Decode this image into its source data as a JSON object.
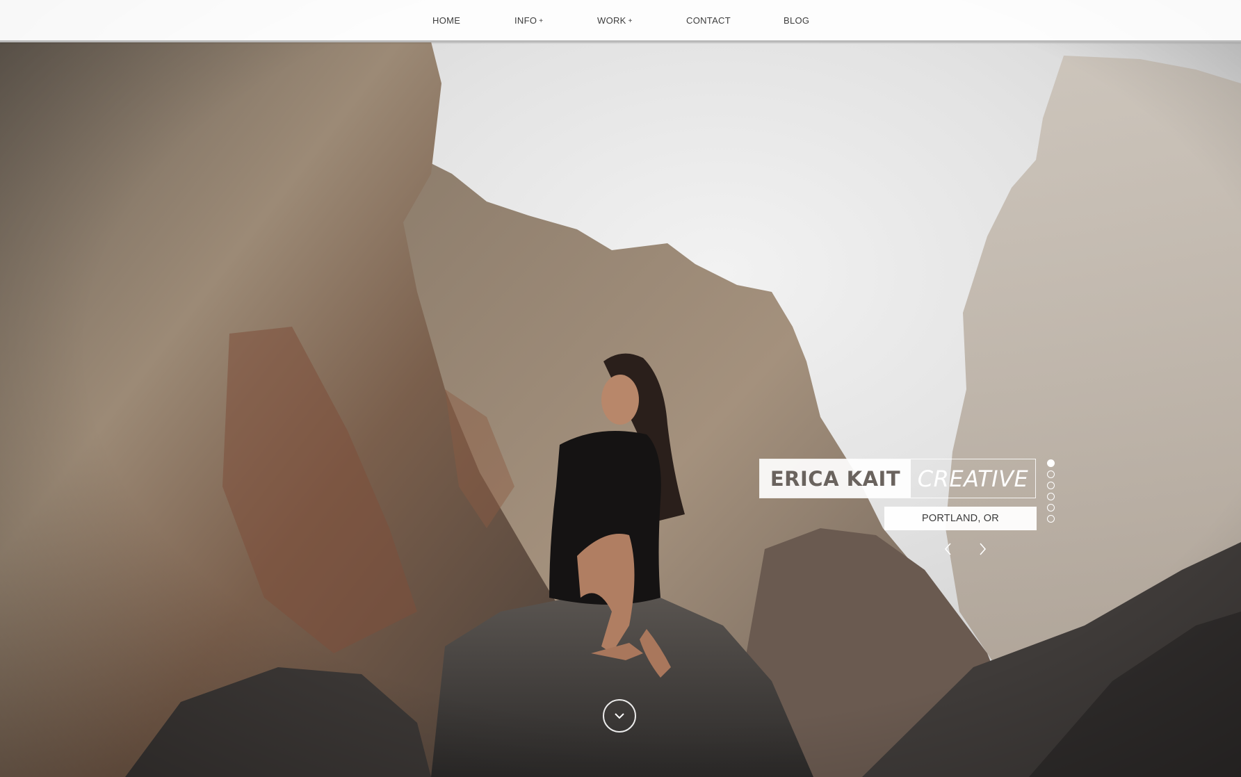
{
  "nav": {
    "items": [
      {
        "label": "HOME",
        "has_submenu": false
      },
      {
        "label": "INFO",
        "has_submenu": true
      },
      {
        "label": "WORK",
        "has_submenu": true
      },
      {
        "label": "CONTACT",
        "has_submenu": false
      },
      {
        "label": "BLOG",
        "has_submenu": false
      }
    ],
    "submenu_marker": "+"
  },
  "hero": {
    "brand_name": "ERICA KAIT",
    "brand_tagline": "CREATIVE",
    "location": "PORTLAND, OR",
    "slide_count": 6,
    "active_slide": 1
  },
  "icons": {
    "prev": "chevron-left-icon",
    "next": "chevron-right-icon",
    "scroll": "chevron-down-icon"
  },
  "colors": {
    "nav_bg": "#ffffff",
    "nav_text": "#3c3c3c",
    "brand_text": "#6a635e",
    "overlay_text": "#ffffff"
  }
}
